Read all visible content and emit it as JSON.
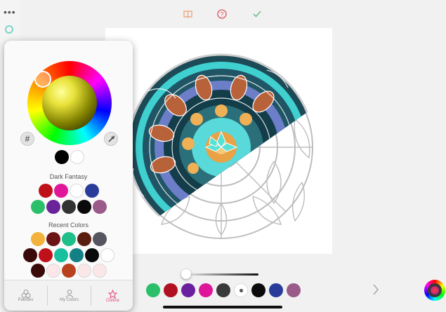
{
  "toolbar": {
    "icons": [
      "book-icon",
      "help-icon",
      "check-icon"
    ],
    "accent": "#f0a070",
    "help_color": "#e0555a",
    "check_color": "#6cc08a"
  },
  "popover": {
    "wheel_button_labels": {
      "hex": "#",
      "eyedropper": "eyedropper"
    },
    "current_colors": [
      "#000000",
      "#ffffff"
    ],
    "palette_title": "Dark Fantasy",
    "palette_colors": [
      [
        "#c0101a",
        "#e0169a",
        "#ffffff",
        "#2a3c9a"
      ],
      [
        "#2bbf6a",
        "#6a249a",
        "#333333",
        "#0a0a0a",
        "#9a5a8a"
      ]
    ],
    "recent_title": "Recent Colors",
    "recent_colors": [
      [
        "#f2b23c",
        "#6a1414",
        "#1fbf8a",
        "#5a1e0e",
        "#555560"
      ],
      [
        "#3a0a0a",
        "#c0101a",
        "#18c0a0",
        "#138085",
        "#0a0a0a",
        "#ffffff"
      ],
      [
        "#3a0a0a",
        "#fbe7e7",
        "#b8421e",
        "#fbe7e7",
        "#fbe7e7"
      ]
    ],
    "tabs": [
      {
        "label": "Palettes",
        "icon": "palettes-icon"
      },
      {
        "label": "My Colors",
        "icon": "person-icon"
      },
      {
        "label": "Outline",
        "icon": "star-icon",
        "active": true
      }
    ]
  },
  "bottom_bar": {
    "palette": [
      "#2bbf6a",
      "#b01020",
      "#6a1fa0",
      "#e0169a",
      "#3a3a3a",
      "dot",
      "#0a0a0a",
      "#2a3c9a",
      "#9a5a8a"
    ]
  }
}
